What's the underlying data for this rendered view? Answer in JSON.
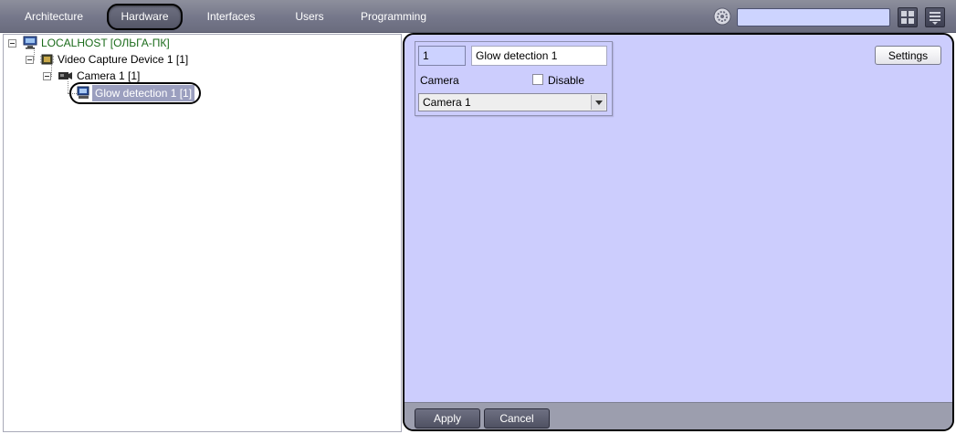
{
  "topbar": {
    "tabs": [
      {
        "label": "Architecture",
        "active": false
      },
      {
        "label": "Hardware",
        "active": true
      },
      {
        "label": "Interfaces",
        "active": false
      },
      {
        "label": "Users",
        "active": false
      },
      {
        "label": "Programming",
        "active": false
      }
    ],
    "search_value": "",
    "icons": [
      "gear-icon",
      "layout-grid-icon",
      "menu-list-icon"
    ]
  },
  "tree": {
    "nodes": [
      {
        "label": "LOCALHOST [ОЛЬГА-ПК]",
        "icon": "computer-icon",
        "level": 0
      },
      {
        "label": "Video Capture Device 1 [1]",
        "icon": "capture-board-icon",
        "level": 1
      },
      {
        "label": "Camera 1 [1]",
        "icon": "camera-icon",
        "level": 2
      },
      {
        "label": "Glow detection 1 [1]",
        "icon": "detector-icon",
        "level": 3,
        "selected": true
      }
    ]
  },
  "panel": {
    "id_value": "1",
    "name_value": "Glow detection 1",
    "camera_label": "Camera",
    "disable_label": "Disable",
    "disable_checked": false,
    "camera_select_value": "Camera 1",
    "settings_label": "Settings",
    "apply_label": "Apply",
    "cancel_label": "Cancel"
  },
  "colors": {
    "topbar": "#75778a",
    "panel_bg": "#cccdfd",
    "selection": "#9b9fbf",
    "root_label": "#1a6b1a",
    "footer": "#9c9eae"
  }
}
